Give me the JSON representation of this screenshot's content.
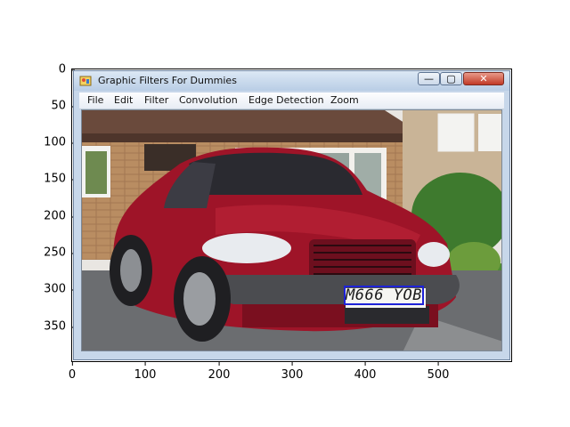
{
  "window": {
    "title": "Graphic Filters For Dummies",
    "icon": "app-paint-icon",
    "controls": {
      "minimize": "—",
      "maximize": "▢",
      "close": "✕"
    }
  },
  "menu": {
    "items": [
      "File",
      "Edit",
      "Filter",
      "Convolution",
      "Edge Detection",
      "Zoom"
    ]
  },
  "image": {
    "subject": "red car",
    "plate_text": "M666 YOB",
    "bbox_color": "#1e22d8"
  },
  "axes": {
    "y_ticks": [
      "0",
      "50",
      "100",
      "150",
      "200",
      "250",
      "300",
      "350"
    ],
    "x_ticks": [
      "0",
      "100",
      "200",
      "300",
      "400",
      "500"
    ]
  }
}
